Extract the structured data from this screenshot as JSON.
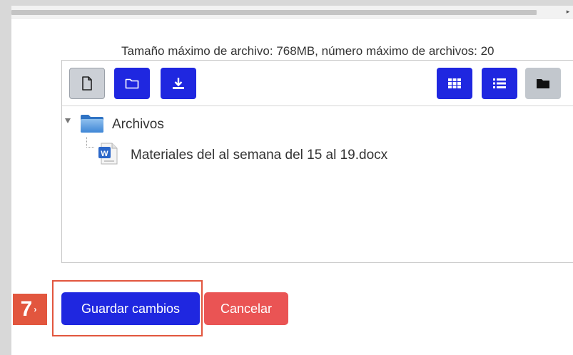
{
  "scrollbar": {
    "arrow_glyph": "▸"
  },
  "filepicker": {
    "max_size_text": "Tamaño máximo de archivo: 768MB, número máximo de archivos: 20",
    "toolbar": {
      "left_buttons": [
        "new-file-icon",
        "new-folder-icon",
        "download-icon"
      ],
      "right_buttons": [
        "grid-view-icon",
        "list-view-icon",
        "tree-view-icon"
      ]
    },
    "tree": {
      "folder_label": "Archivos",
      "file_label": "Materiales del al semana del 15 al 19.docx",
      "file_icon": "word-document-icon"
    }
  },
  "step": {
    "number": "7",
    "arrow": "›"
  },
  "actions": {
    "save_label": "Guardar cambios",
    "cancel_label": "Cancelar"
  },
  "colors": {
    "primary": "#1f27e0",
    "danger": "#ea5454",
    "step_badge": "#e2563e"
  }
}
